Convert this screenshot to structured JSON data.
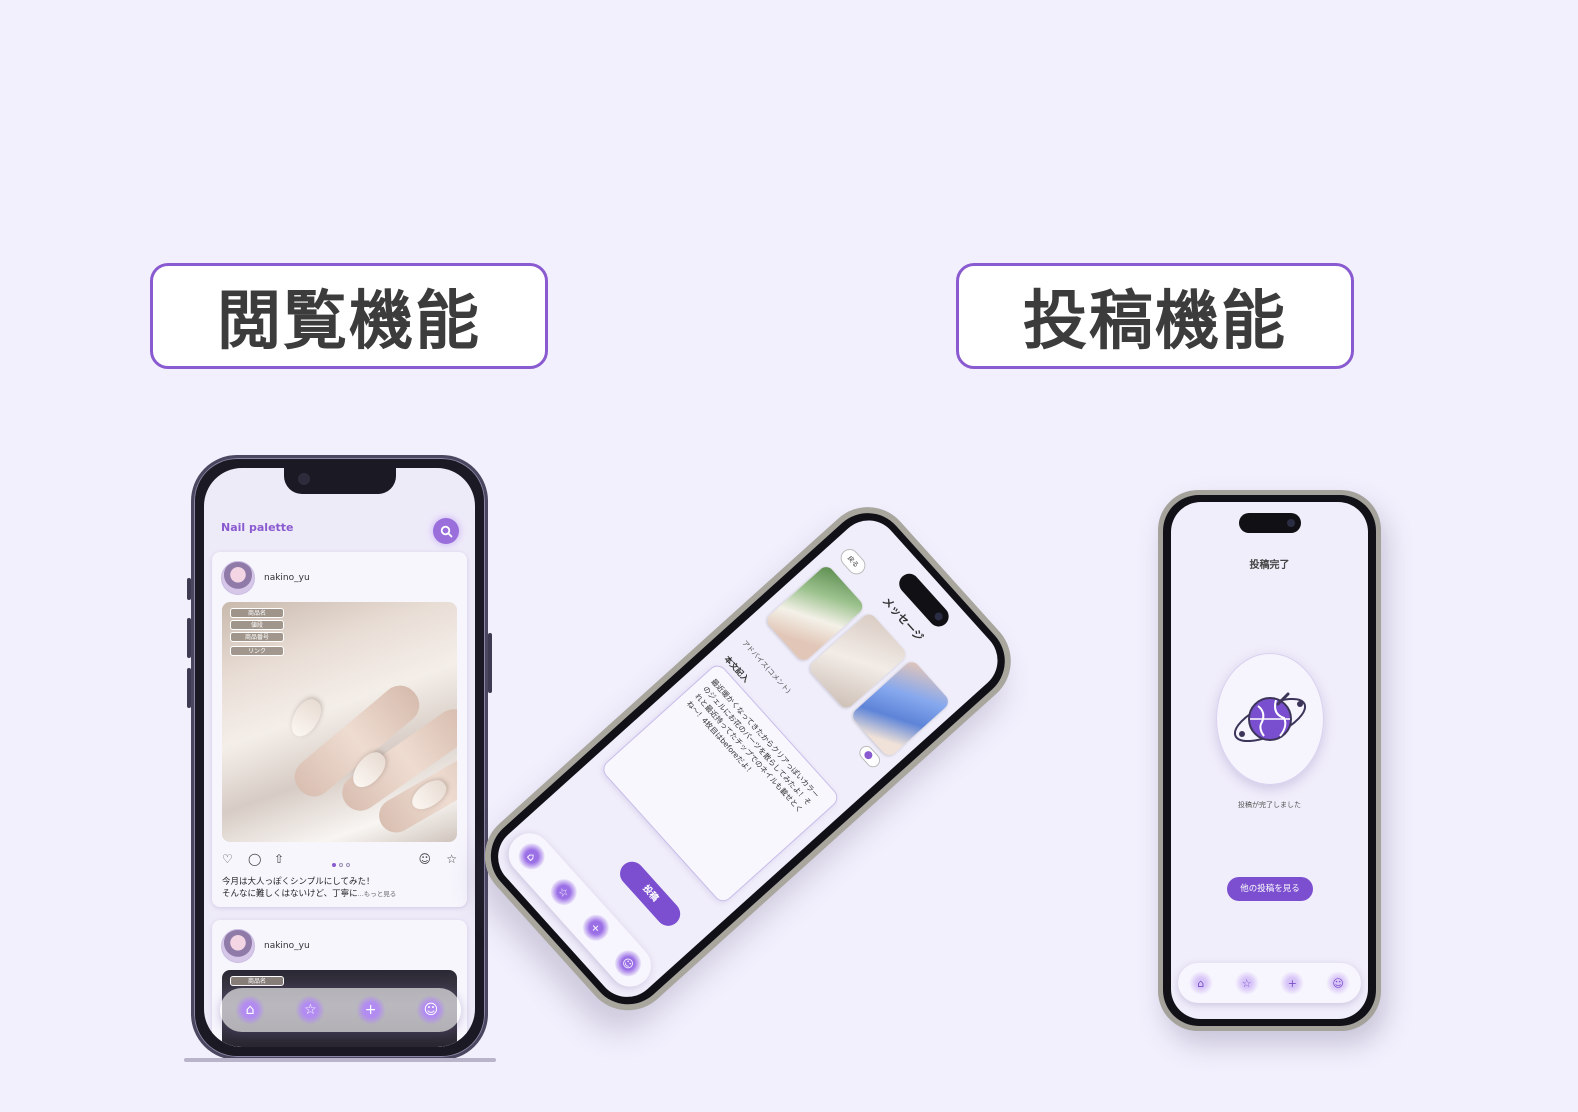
{
  "labels": {
    "browse": "閲覧機能",
    "post": "投稿機能"
  },
  "browse_phone": {
    "app_title": "Nail palette",
    "search_icon": "search-icon",
    "posts": [
      {
        "username": "nakino_yu",
        "tags": [
          "商品名",
          "値段",
          "商品番号",
          "リンク"
        ],
        "caption_line1": "今月は大人っぽくシンプルにしてみた！",
        "caption_line2": "そんなに難しくはないけど、丁寧に",
        "more": "...もっと見る"
      },
      {
        "username": "nakino_yu",
        "tags": [
          "商品名"
        ]
      }
    ],
    "tabbar_icons": [
      "home-icon",
      "star-icon",
      "plus-icon",
      "user-icon"
    ]
  },
  "post_phone": {
    "back": "戻る",
    "title": "メッセージ",
    "advice_label": "アドバイス(コメント)",
    "body_label": "本文記入",
    "body_text": "最近暖かくなってきたからクリアっぽいカラーのジェルにお花のパーツを散らしてみたよ！それと最近持ってたチップでのネイルも載せとくね〜！4枚目はbeforeだよ！",
    "post_button": "投稿",
    "tabbar_icons": [
      "home-icon",
      "star-icon",
      "plus-icon",
      "user-icon"
    ]
  },
  "complete_phone": {
    "title": "投稿完了",
    "message": "投稿が完了しました",
    "other_button": "他の投稿を見る",
    "tabbar_icons": [
      "home-icon",
      "star-icon",
      "plus-icon",
      "user-icon"
    ]
  },
  "colors": {
    "background": "#f2f0fd",
    "accent": "#8a5bd0",
    "button": "#7b4fcf"
  }
}
